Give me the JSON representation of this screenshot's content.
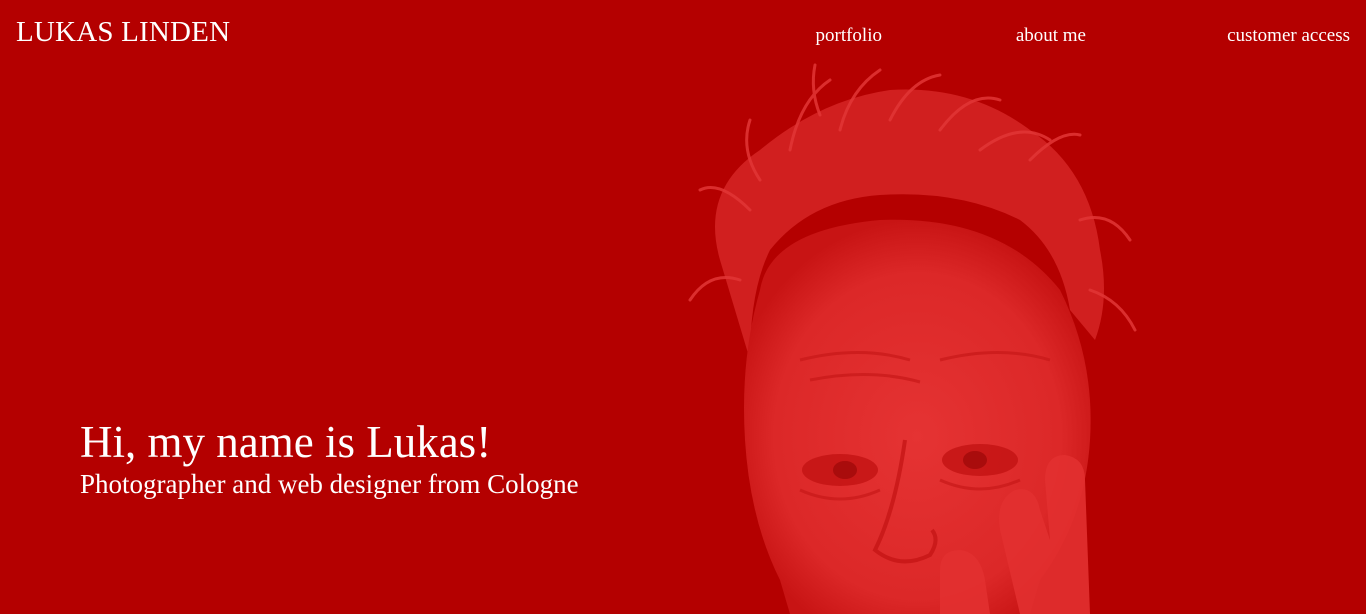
{
  "brand": "LUKAS LINDEN",
  "nav": {
    "portfolio": "portfolio",
    "about": "about me",
    "customer": "customer access"
  },
  "hero": {
    "heading": "Hi, my name is Lukas!",
    "subheading": "Photographer and web designer from Cologne"
  },
  "colors": {
    "background": "#b40000",
    "portrait_tint": "#e02a2a",
    "text": "#ffffff"
  }
}
